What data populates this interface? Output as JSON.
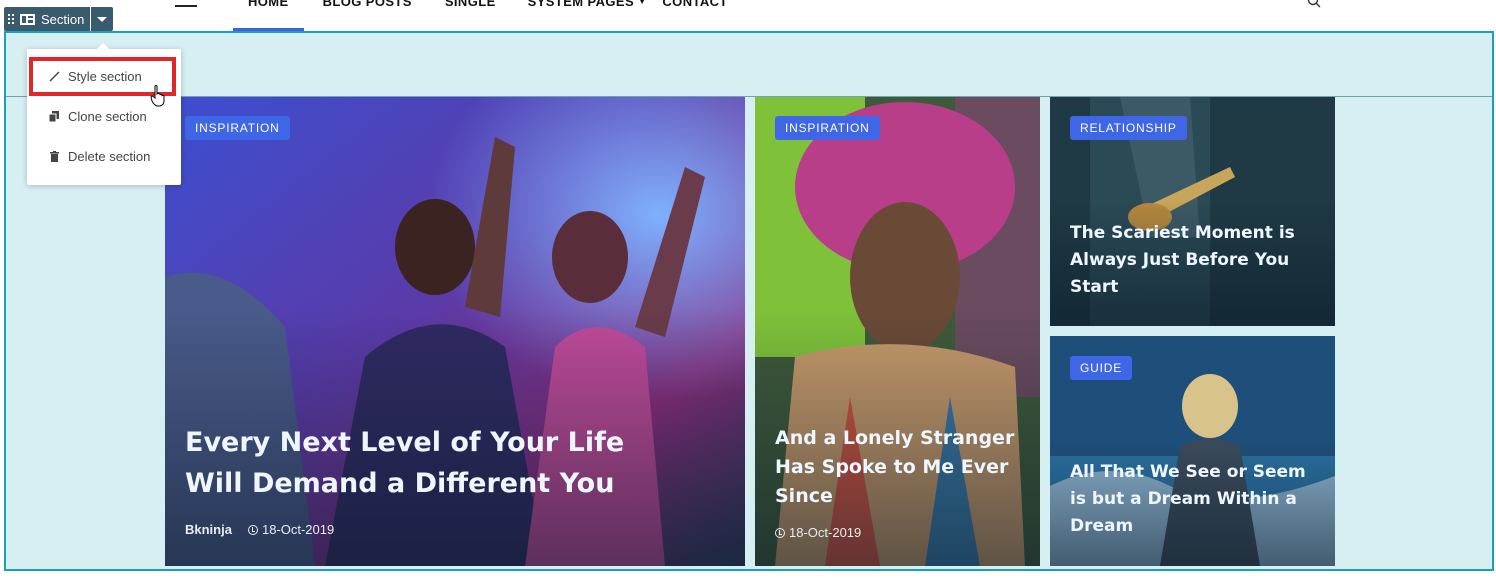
{
  "nav": {
    "items": [
      {
        "label": "HOME"
      },
      {
        "label": "BLOG POSTS"
      },
      {
        "label": "SINGLE"
      },
      {
        "label": "SYSTEM PAGES"
      },
      {
        "label": "CONTACT"
      }
    ],
    "active_index": 0
  },
  "section_toolbar": {
    "label": "Section"
  },
  "section_menu": {
    "items": [
      {
        "label": "Style section",
        "icon": "pencil-icon"
      },
      {
        "label": "Clone section",
        "icon": "copy-icon"
      },
      {
        "label": "Delete section",
        "icon": "trash-icon"
      }
    ]
  },
  "posts": [
    {
      "category": "INSPIRATION",
      "title": "Every Next Level of Your Life Will Demand a Different You",
      "author": "Bkninja",
      "date": "18-Oct-2019",
      "image": "party-crowd-image"
    },
    {
      "category": "INSPIRATION",
      "title": "And a Lonely Stranger Has Spoke to Me Ever Since",
      "date": "18-Oct-2019",
      "image": "street-mural-image"
    },
    {
      "category": "RELATIONSHIP",
      "title": "The Scariest Moment is Always Just Before You Start",
      "image": "guitarist-image"
    },
    {
      "category": "GUIDE",
      "title": "All That We See or Seem is but a Dream Within a Dream",
      "image": "ocean-person-image"
    }
  ],
  "colors": {
    "accent": "#3f66e6",
    "frame": "#1ba0b4",
    "toolbar": "#3a5a6e",
    "highlight": "#e0262b"
  }
}
